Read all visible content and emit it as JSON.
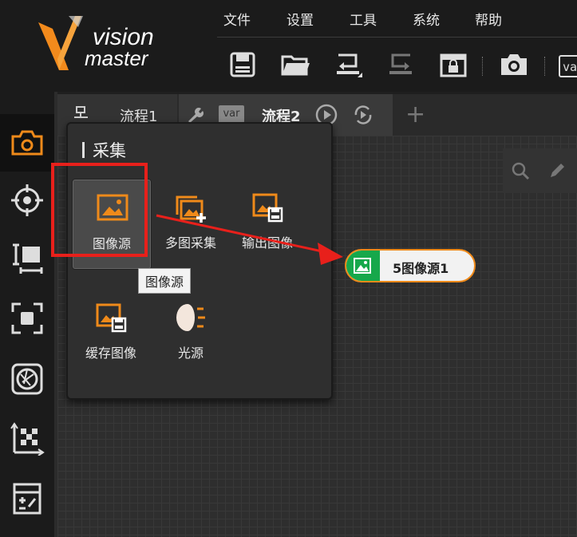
{
  "app": {
    "logo_brand": "vision",
    "logo_sub": "master"
  },
  "menu": [
    "文件",
    "设置",
    "工具",
    "系统",
    "帮助"
  ],
  "toolbar": {
    "icons": [
      "save-icon",
      "open-folder-icon",
      "import-icon",
      "export-icon",
      "lock-icon",
      "camera-icon"
    ],
    "var_chip": "va"
  },
  "tabs": [
    {
      "label": "流程1",
      "icons": [
        "flow-icon"
      ]
    },
    {
      "label": "流程2",
      "icons": [
        "wrench-icon",
        "var-icon",
        "play-icon",
        "loop-icon"
      ],
      "active": true
    }
  ],
  "tab_var_label": "var",
  "add_tab": "+",
  "sidebar": [
    "camera-icon",
    "target-icon",
    "measure-icon",
    "focus-icon",
    "aperture-icon",
    "calibration-icon",
    "calculator-icon"
  ],
  "popup": {
    "title": "采集",
    "tools": [
      {
        "label": "图像源",
        "icon": "image-source-icon",
        "selected": true
      },
      {
        "label": "多图采集",
        "icon": "multi-image-icon"
      },
      {
        "label": "输出图像",
        "icon": "output-image-icon"
      },
      {
        "label": "缓存图像",
        "icon": "cache-image-icon"
      },
      {
        "label": "光源",
        "icon": "light-source-icon"
      }
    ],
    "tooltip": "图像源"
  },
  "node": {
    "label": "5图像源1",
    "icon": "image-icon"
  },
  "colors": {
    "accent": "#ef8a1a",
    "highlight": "#e8201b",
    "node_icon_bg": "#16a84b"
  }
}
